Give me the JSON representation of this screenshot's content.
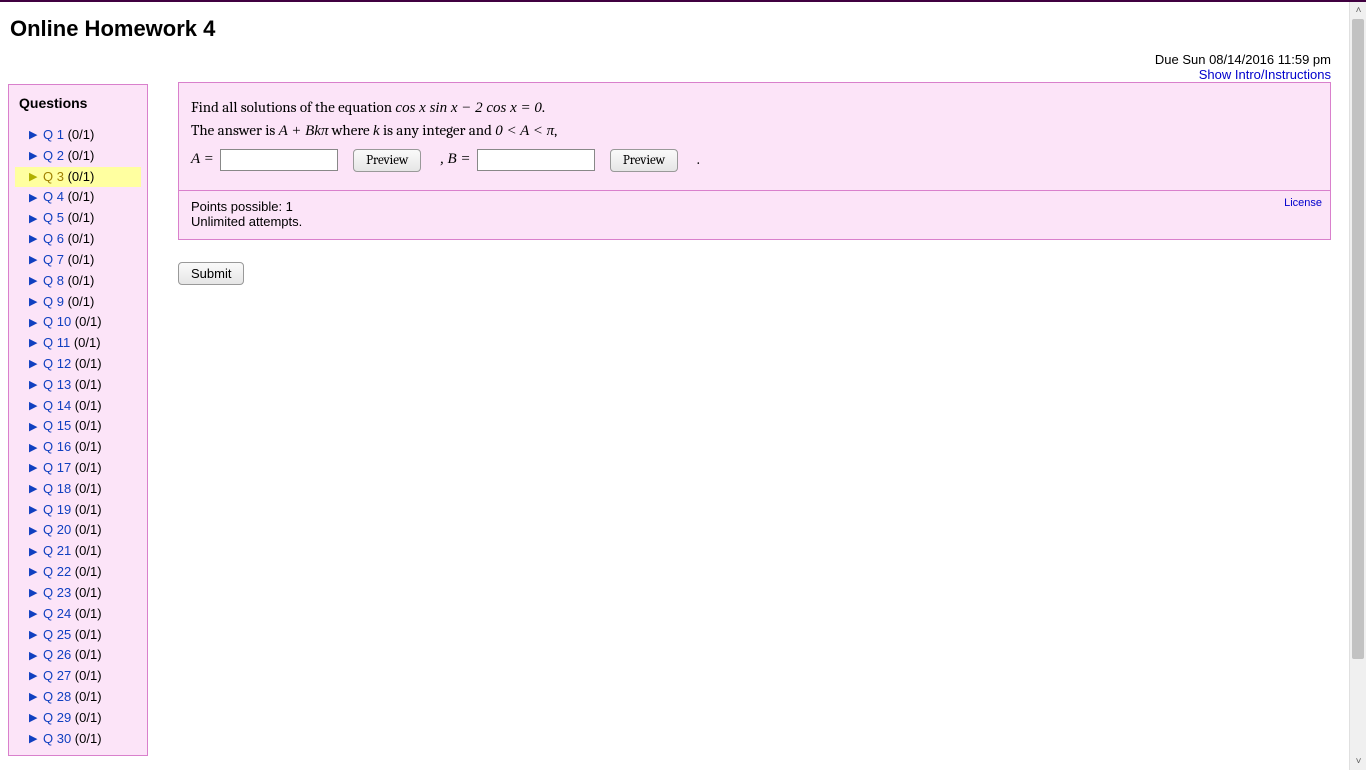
{
  "header": {
    "title": "Online Homework 4",
    "due_label": "Due Sun 08/14/2016 11:59 pm",
    "show_intro": "Show Intro/Instructions"
  },
  "sidebar": {
    "heading": "Questions",
    "active_index": 2,
    "items": [
      {
        "label": "Q 1",
        "score": "(0/1)"
      },
      {
        "label": "Q 2",
        "score": "(0/1)"
      },
      {
        "label": "Q 3",
        "score": "(0/1)"
      },
      {
        "label": "Q 4",
        "score": "(0/1)"
      },
      {
        "label": "Q 5",
        "score": "(0/1)"
      },
      {
        "label": "Q 6",
        "score": "(0/1)"
      },
      {
        "label": "Q 7",
        "score": "(0/1)"
      },
      {
        "label": "Q 8",
        "score": "(0/1)"
      },
      {
        "label": "Q 9",
        "score": "(0/1)"
      },
      {
        "label": "Q 10",
        "score": "(0/1)"
      },
      {
        "label": "Q 11",
        "score": "(0/1)"
      },
      {
        "label": "Q 12",
        "score": "(0/1)"
      },
      {
        "label": "Q 13",
        "score": "(0/1)"
      },
      {
        "label": "Q 14",
        "score": "(0/1)"
      },
      {
        "label": "Q 15",
        "score": "(0/1)"
      },
      {
        "label": "Q 16",
        "score": "(0/1)"
      },
      {
        "label": "Q 17",
        "score": "(0/1)"
      },
      {
        "label": "Q 18",
        "score": "(0/1)"
      },
      {
        "label": "Q 19",
        "score": "(0/1)"
      },
      {
        "label": "Q 20",
        "score": "(0/1)"
      },
      {
        "label": "Q 21",
        "score": "(0/1)"
      },
      {
        "label": "Q 22",
        "score": "(0/1)"
      },
      {
        "label": "Q 23",
        "score": "(0/1)"
      },
      {
        "label": "Q 24",
        "score": "(0/1)"
      },
      {
        "label": "Q 25",
        "score": "(0/1)"
      },
      {
        "label": "Q 26",
        "score": "(0/1)"
      },
      {
        "label": "Q 27",
        "score": "(0/1)"
      },
      {
        "label": "Q 28",
        "score": "(0/1)"
      },
      {
        "label": "Q 29",
        "score": "(0/1)"
      },
      {
        "label": "Q 30",
        "score": "(0/1)"
      }
    ]
  },
  "question": {
    "line1_pre": "Find all solutions of the equation ",
    "line1_math": "cos x sin x − 2 cos x = 0.",
    "line2_pre": "The answer is ",
    "line2_math": "A + Bkπ",
    "line2_mid": " where ",
    "line2_k": "k",
    "line2_post1": " is any integer and ",
    "line2_cond": "0 < A < π",
    "line2_comma": ",",
    "a_label": "A =",
    "b_label": ", B =",
    "preview_a": "Preview",
    "preview_b": "Preview",
    "period": "."
  },
  "footer": {
    "points": "Points possible: 1",
    "attempts": "Unlimited attempts.",
    "license": "License"
  },
  "submit_label": "Submit"
}
